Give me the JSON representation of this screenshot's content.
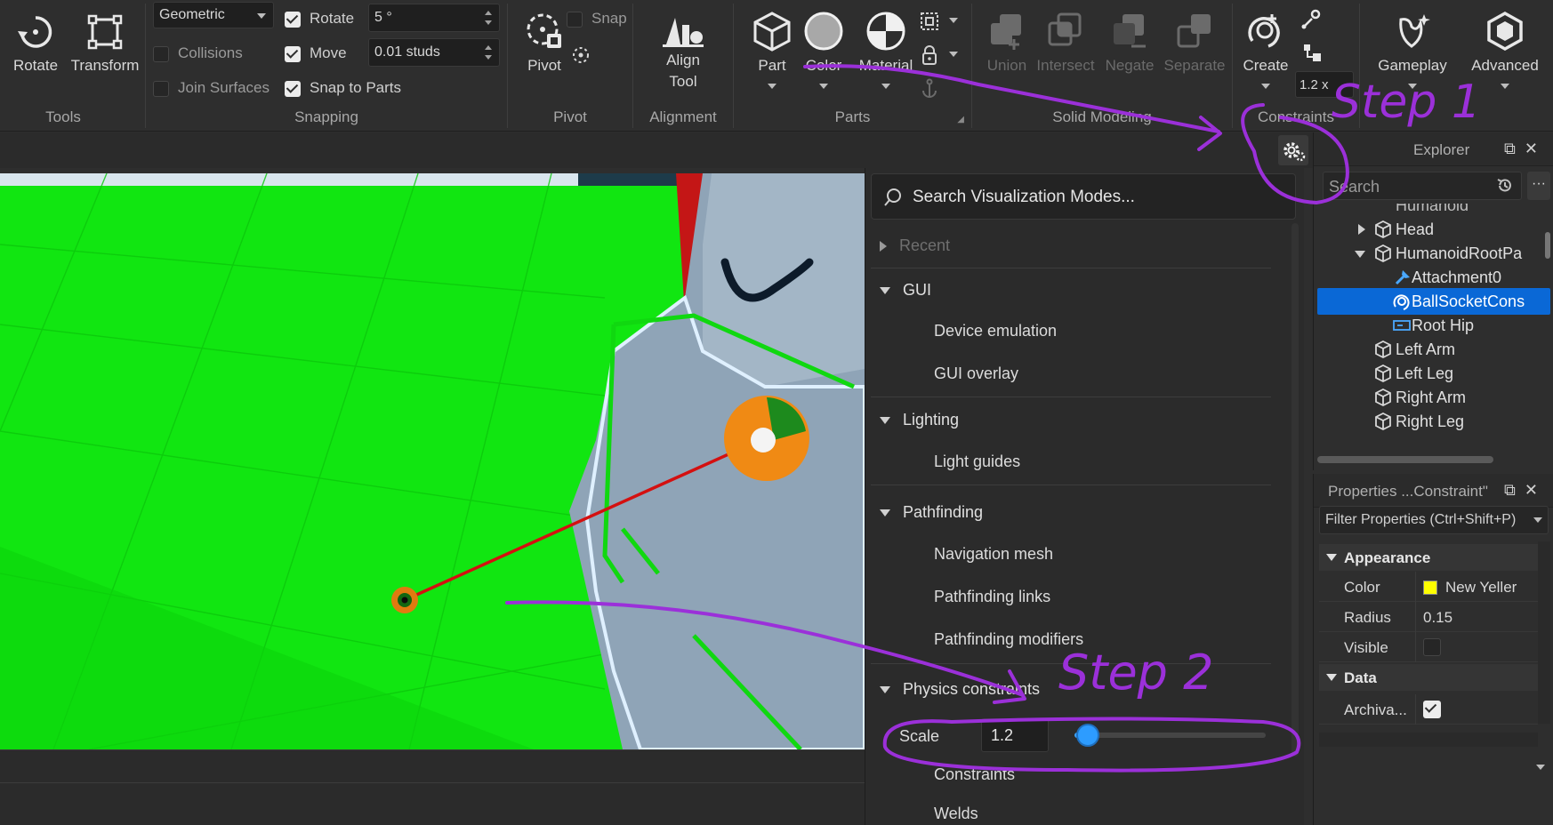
{
  "colors": {
    "annotation": "#9b30d9",
    "selection": "#0a68d6",
    "slider": "#2d9cff",
    "ground": "#0ee80e"
  },
  "ribbon": {
    "tools": {
      "rotate_label": "Rotate",
      "transform_label": "Transform",
      "group_label": "Tools"
    },
    "snapping": {
      "mode_value": "Geometric",
      "collisions_label": "Collisions",
      "join_surfaces_label": "Join Surfaces",
      "rotate_label": "Rotate",
      "rotate_value": "5 °",
      "move_label": "Move",
      "move_value": "0.01 studs",
      "snap_to_parts_label": "Snap to Parts",
      "group_label": "Snapping"
    },
    "pivot": {
      "pivot_label": "Pivot",
      "snap_label": "Snap",
      "group_label": "Pivot"
    },
    "alignment": {
      "align_label": "Align",
      "tool_label": "Tool",
      "group_label": "Alignment"
    },
    "parts": {
      "part_label": "Part",
      "color_label": "Color",
      "material_label": "Material",
      "group_label": "Parts"
    },
    "solid_modeling": {
      "union_label": "Union",
      "intersect_label": "Intersect",
      "negate_label": "Negate",
      "separate_label": "Separate",
      "group_label": "Solid Modeling"
    },
    "constraints": {
      "create_label": "Create",
      "scale_value": "1.2 x",
      "group_label": "Constraints"
    },
    "gameplay_label": "Gameplay",
    "advanced_label": "Advanced"
  },
  "viz": {
    "search_placeholder": "Search Visualization Modes...",
    "recent_label": "Recent",
    "gui_label": "GUI",
    "gui_items": [
      "Device emulation",
      "GUI overlay"
    ],
    "lighting_label": "Lighting",
    "lighting_items": [
      "Light guides"
    ],
    "pathfinding_label": "Pathfinding",
    "pathfinding_items": [
      "Navigation mesh",
      "Pathfinding links",
      "Pathfinding modifiers"
    ],
    "physics_label": "Physics constraints",
    "scale_label": "Scale",
    "scale_value": "1.2",
    "scale_fraction": 0.07,
    "physics_items": [
      "Constraints",
      "Welds"
    ]
  },
  "explorer": {
    "title": "Explorer",
    "search_placeholder": "Search",
    "more_label": "···",
    "tree": {
      "humanoid": "Humanoid",
      "head": "Head",
      "root_part": "HumanoidRootPa",
      "attachment0": "Attachment0",
      "ballsocket": "BallSocketCons",
      "root_hip": "Root Hip",
      "left_arm": "Left Arm",
      "left_leg": "Left Leg",
      "right_arm": "Right Arm",
      "right_leg": "Right Leg"
    }
  },
  "properties": {
    "title": "Properties ...Constraint\"",
    "filter_placeholder": "Filter Properties (Ctrl+Shift+P)",
    "appearance_label": "Appearance",
    "color_label": "Color",
    "color_value": "New Yeller",
    "radius_label": "Radius",
    "radius_value": "0.15",
    "visible_label": "Visible",
    "data_label": "Data",
    "archivable_label": "Archiva..."
  },
  "annotations": {
    "step1": "Step 1",
    "step2": "Step 2"
  }
}
